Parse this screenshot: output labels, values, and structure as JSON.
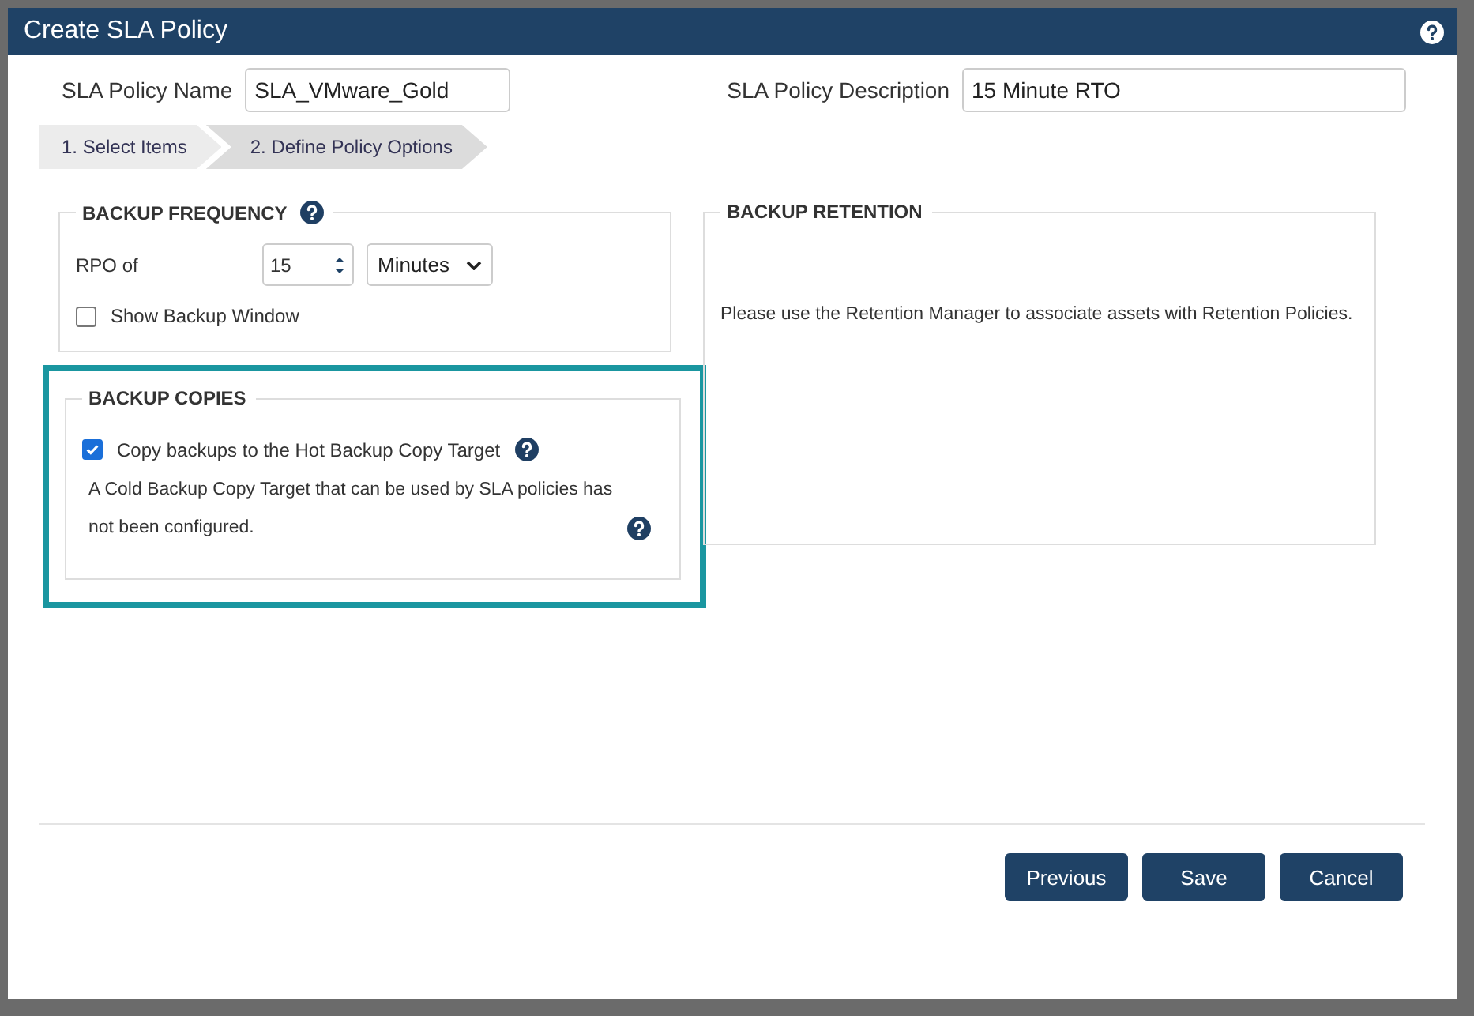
{
  "dialog": {
    "title": "Create SLA Policy"
  },
  "fields": [
    {
      "label": "SLA Policy Name",
      "value": "SLA_VMware_Gold"
    },
    {
      "label": "SLA Policy Description",
      "value": "15 Minute RTO"
    }
  ],
  "steps": [
    {
      "label": "1. Select Items",
      "selected": false
    },
    {
      "label": "2. Define Policy Options",
      "selected": true
    }
  ],
  "backup_frequency": {
    "title": "BACKUP FREQUENCY",
    "rpo_label": "RPO of",
    "rpo_value": "15",
    "unit": "Minutes",
    "show_window": {
      "label": "Show Backup Window",
      "checked": false
    }
  },
  "backup_copies": {
    "title": "BACKUP COPIES",
    "highlighted": true,
    "hot_copy": {
      "label": "Copy backups to the Hot Backup Copy Target",
      "checked": true
    },
    "cold_note": "A Cold Backup Copy Target that can be used by SLA policies has not been configured."
  },
  "backup_retention": {
    "title": "BACKUP RETENTION",
    "message": "Please use the Retention Manager to associate assets with Retention Policies."
  },
  "buttons": [
    "Previous",
    "Save",
    "Cancel"
  ]
}
